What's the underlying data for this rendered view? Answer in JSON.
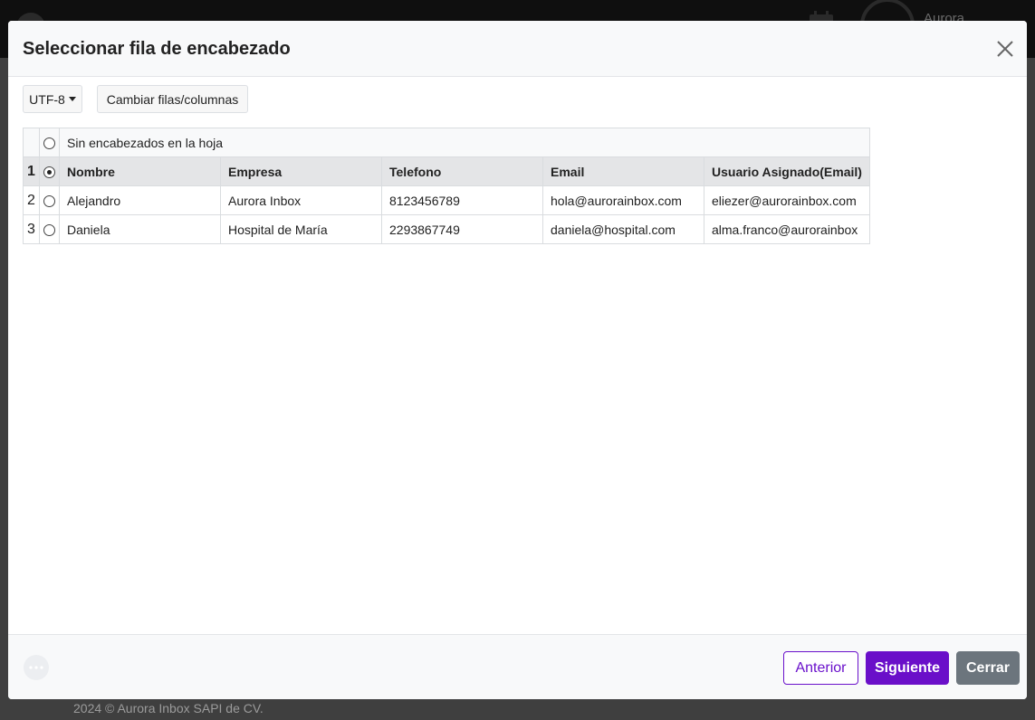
{
  "background": {
    "user_name": "Aurora",
    "footer_text": "2024 © Aurora Inbox SAPI de CV."
  },
  "modal": {
    "title": "Seleccionar fila de encabezado",
    "toolbar": {
      "encoding_label": "UTF-8",
      "swap_label": "Cambiar filas/columnas"
    },
    "no_header_label": "Sin encabezados en la hoja",
    "selected_row": 1,
    "rows": [
      {
        "num": "1",
        "cells": [
          "Nombre",
          "Empresa",
          "Telefono",
          "Email",
          "Usuario Asignado(Email)"
        ]
      },
      {
        "num": "2",
        "cells": [
          "Alejandro",
          "Aurora Inbox",
          "8123456789",
          "hola@aurorainbox.com",
          "eliezer@aurorainbox.com"
        ]
      },
      {
        "num": "3",
        "cells": [
          "Daniela",
          "Hospital de María",
          "2293867749",
          "daniela@hospital.com",
          "alma.franco@aurorainbox"
        ]
      }
    ],
    "footer": {
      "prev_label": "Anterior",
      "next_label": "Siguiente",
      "close_label": "Cerrar"
    }
  },
  "colors": {
    "primary": "#6a0fc9",
    "secondary": "#6c757d",
    "overlay": "#3f3f3f"
  }
}
